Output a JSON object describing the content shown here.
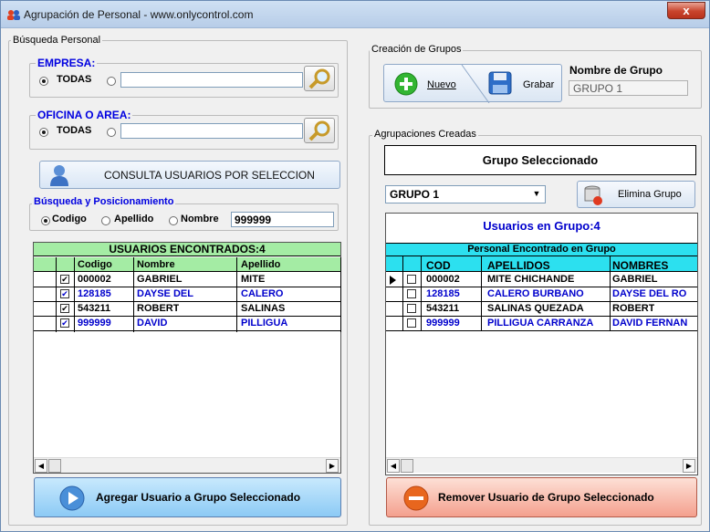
{
  "window": {
    "title": "Agrupación de Personal - www.onlycontrol.com",
    "close_label": "x"
  },
  "busqueda": {
    "legend": "Búsqueda Personal"
  },
  "empresa": {
    "legend": "EMPRESA:",
    "todas_label": "TODAS",
    "selected": "TODAS"
  },
  "oficina": {
    "legend": "OFICINA O AREA:",
    "todas_label": "TODAS",
    "selected": "TODAS"
  },
  "consulta": {
    "label": "CONSULTA USUARIOS POR SELECCION"
  },
  "posicionamiento": {
    "legend": "Búsqueda y Posicionamiento",
    "options": [
      "Codigo",
      "Apellido",
      "Nombre"
    ],
    "selected": "Codigo",
    "value": "999999"
  },
  "found_table": {
    "title": "USUARIOS ENCONTRADOS:4",
    "columns": [
      "Codigo",
      "Nombre",
      "Apellido"
    ],
    "rows": [
      {
        "codigo": "000002",
        "nombre": "GABRIEL",
        "apellido": "MITE",
        "checked": true,
        "color": "#000000"
      },
      {
        "codigo": "128185",
        "nombre": "DAYSE DEL",
        "apellido": "CALERO",
        "checked": true,
        "color": "#0000cc"
      },
      {
        "codigo": "543211",
        "nombre": "ROBERT",
        "apellido": "SALINAS",
        "checked": true,
        "color": "#000000"
      },
      {
        "codigo": "999999",
        "nombre": "DAVID",
        "apellido": "PILLIGUA",
        "checked": true,
        "color": "#0000cc"
      }
    ]
  },
  "add_button": {
    "label": "Agregar Usuario a Grupo Seleccionado"
  },
  "creacion": {
    "legend": "Creación de Grupos",
    "nuevo_label": "Nuevo",
    "grabar_label": "Grabar",
    "nombre_label": "Nombre de Grupo",
    "nombre_value": "GRUPO 1"
  },
  "agrupaciones": {
    "legend": "Agrupaciones Creadas",
    "grupo_sel_label": "Grupo Seleccionado",
    "combo_value": "GRUPO 1",
    "elimina_label": "Elimina Grupo",
    "usuarios_label": "Usuarios en Grupo:4"
  },
  "group_table": {
    "title": "Personal Encontrado en Grupo",
    "columns": [
      "COD",
      "APELLIDOS",
      "NOMBRES"
    ],
    "rows": [
      {
        "cod": "000002",
        "apellidos": "MITE CHICHANDE",
        "nombres": "GABRIEL",
        "checked": false,
        "color": "#000000",
        "current": true
      },
      {
        "cod": "128185",
        "apellidos": "CALERO BURBANO",
        "nombres": "DAYSE DEL RO",
        "checked": false,
        "color": "#0000cc",
        "current": false
      },
      {
        "cod": "543211",
        "apellidos": "SALINAS QUEZADA",
        "nombres": "ROBERT",
        "checked": false,
        "color": "#000000",
        "current": false
      },
      {
        "cod": "999999",
        "apellidos": "PILLIGUA CARRANZA",
        "nombres": "DAVID FERNAN",
        "checked": false,
        "color": "#0000cc",
        "current": false
      }
    ]
  },
  "remove_button": {
    "label": "Remover Usuario de Grupo Seleccionado"
  },
  "colors": {
    "green_header": "#a4eca4",
    "cyan_header": "#2ce0ef",
    "blue_text": "#0000cc",
    "add_button": "#a8d8f8",
    "remove_button": "#f8b0a0"
  }
}
